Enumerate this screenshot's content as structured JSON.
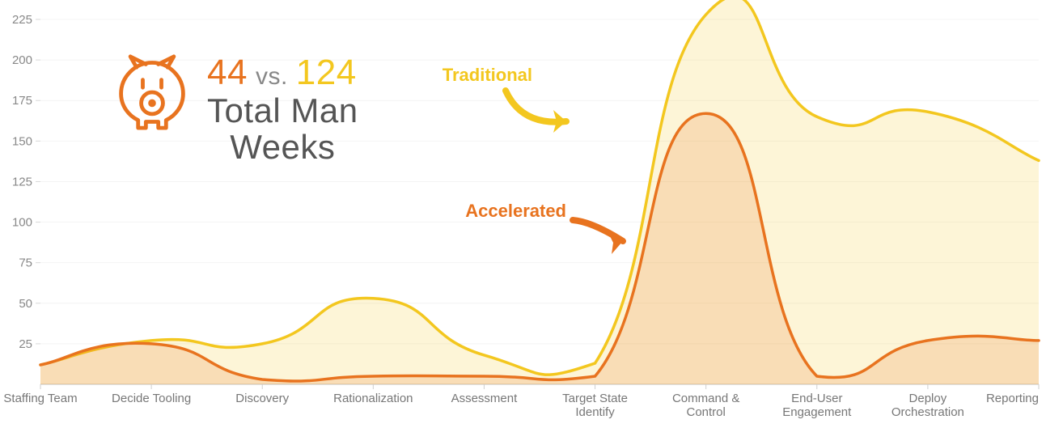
{
  "headline": {
    "value_accelerated": "44",
    "vs": "vs.",
    "value_traditional": "124",
    "subtitle_line1": "Total Man",
    "subtitle_line2": "Weeks"
  },
  "annotations": {
    "traditional": "Traditional",
    "accelerated": "Accelerated"
  },
  "colors": {
    "traditional": "#f3c71f",
    "accelerated": "#e8731f",
    "axis": "#888",
    "grid": "#f4f4f4"
  },
  "chart_data": {
    "type": "area",
    "xlabel": "",
    "ylabel": "",
    "ylim": [
      0,
      225
    ],
    "yticks": [
      25,
      50,
      75,
      100,
      125,
      150,
      175,
      200,
      225
    ],
    "categories": [
      "Staffing Team",
      "Decide Tooling",
      "Discovery",
      "Rationalization",
      "Assessment",
      "Target State Identify",
      "Command & Control",
      "End-User Engagement",
      "Deploy Orchestration",
      "Reporting"
    ],
    "series": [
      {
        "name": "Traditional",
        "color": "#f3c71f",
        "values": [
          12,
          27,
          25,
          53,
          18,
          13,
          228,
          165,
          168,
          138
        ]
      },
      {
        "name": "Accelerated",
        "color": "#e8731f",
        "values": [
          12,
          25,
          3,
          5,
          5,
          5,
          167,
          5,
          27,
          27
        ]
      }
    ]
  }
}
